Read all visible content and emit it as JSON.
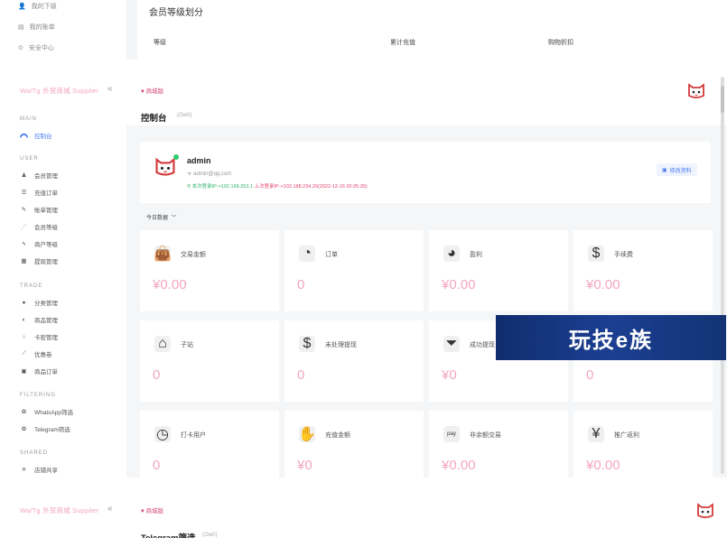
{
  "top_strip": {
    "sidebar_items": [
      "我的下级",
      "我的账单",
      "安全中心"
    ],
    "panel_title": "会员等级划分",
    "columns": [
      "等级",
      "累计充值",
      "购物折扣"
    ]
  },
  "brand": "Wa/Tg 外贸商城 Supplier",
  "sidebar": {
    "sections": {
      "main": "MAIN",
      "user": "USER",
      "trade": "TRADE",
      "filtering": "FILTERING",
      "shared": "SHARED"
    },
    "main_items": [
      "控制台"
    ],
    "user_items": [
      "会员管理",
      "充值订单",
      "账单管理",
      "会员等级",
      "商户等级",
      "提现管理"
    ],
    "trade_items": [
      "分类管理",
      "商品管理",
      "卡密管理",
      "优惠卷",
      "商品订单"
    ],
    "filtering_items": [
      "WhatsApp筛选",
      "Telegram筛选"
    ],
    "shared_items": [
      "店铺共享"
    ]
  },
  "header": {
    "tag": "♥ 商城版",
    "page_title": "控制台",
    "page_subtitle": "(Ow0)"
  },
  "profile": {
    "name": "admin",
    "email": "admin@qq.com",
    "current_ip": "本次登录IP->192.168.253.1",
    "last_login": "上次登录IP->103.188.234.20(2022-12-16 20:25:35)",
    "edit_label": "修改资料"
  },
  "filter_label": "今日数据",
  "stats": [
    {
      "label": "交易金额",
      "value": "¥0.00"
    },
    {
      "label": "订单",
      "value": "0"
    },
    {
      "label": "盈利",
      "value": "¥0.00"
    },
    {
      "label": "手续费",
      "value": "¥0.00"
    },
    {
      "label": "子站",
      "value": "0"
    },
    {
      "label": "未处理提现",
      "value": "0"
    },
    {
      "label": "成功提现",
      "value": "¥0"
    },
    {
      "label": "",
      "value": "0"
    },
    {
      "label": "打卡用户",
      "value": "0"
    },
    {
      "label": "充值金额",
      "value": "¥0"
    },
    {
      "label": "非余额交易",
      "value": "¥0.00"
    },
    {
      "label": "推广返利",
      "value": "¥0.00"
    }
  ],
  "watermark": "玩技e族",
  "bottom_strip": {
    "brand": "Wa/Tg 外贸商城 Supplier",
    "tag": "♥ 商城版",
    "page_title": "Telegram筛选",
    "page_subtitle": "(Ow0)"
  },
  "colors": {
    "accent": "#4a7cf0",
    "pink": "#f3a6bc",
    "online": "#2ecc71",
    "ip_green": "#2fb36a",
    "ip_red": "#e0466f"
  }
}
